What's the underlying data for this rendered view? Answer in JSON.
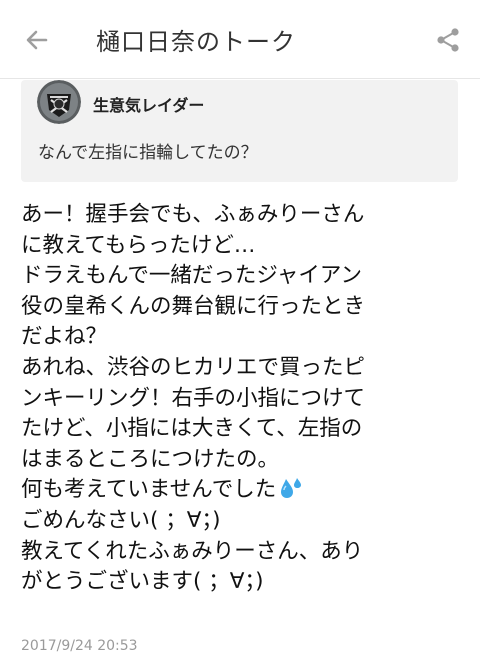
{
  "header": {
    "title": "樋口日奈のトーク",
    "back_icon": "arrow-left-icon",
    "share_icon": "share-icon"
  },
  "quoted": {
    "author": "生意気レイダー",
    "text": "なんで左指に指輪してたの？",
    "avatar_icon": "raiders-logo-avatar"
  },
  "post": {
    "lines": [
      "あー！握手会でも、ふぁみりーさん",
      "に教えてもらったけど…",
      "ドラえもんで一緒だったジャイアン",
      "役の皇希くんの舞台観に行ったとき",
      "だよね？",
      "あれね、渋谷のヒカリエで買ったピ",
      "ンキーリング！右手の小指につけて",
      "たけど、小指には大きくて、左指の",
      "はまるところにつけたの。",
      "何も考えていませんでした",
      "ごめんなさい( ；∀；)",
      "教えてくれたふぁみりーさん、あり",
      "がとうございます( ；∀；)"
    ],
    "sweat_icon": "sweat-drops-emoji",
    "timestamp": "2017/9/24 20:53"
  },
  "colors": {
    "quote_bg": "#f2f2f2",
    "icon_gray": "#9e9e9e",
    "timestamp": "#9a9a9a"
  }
}
